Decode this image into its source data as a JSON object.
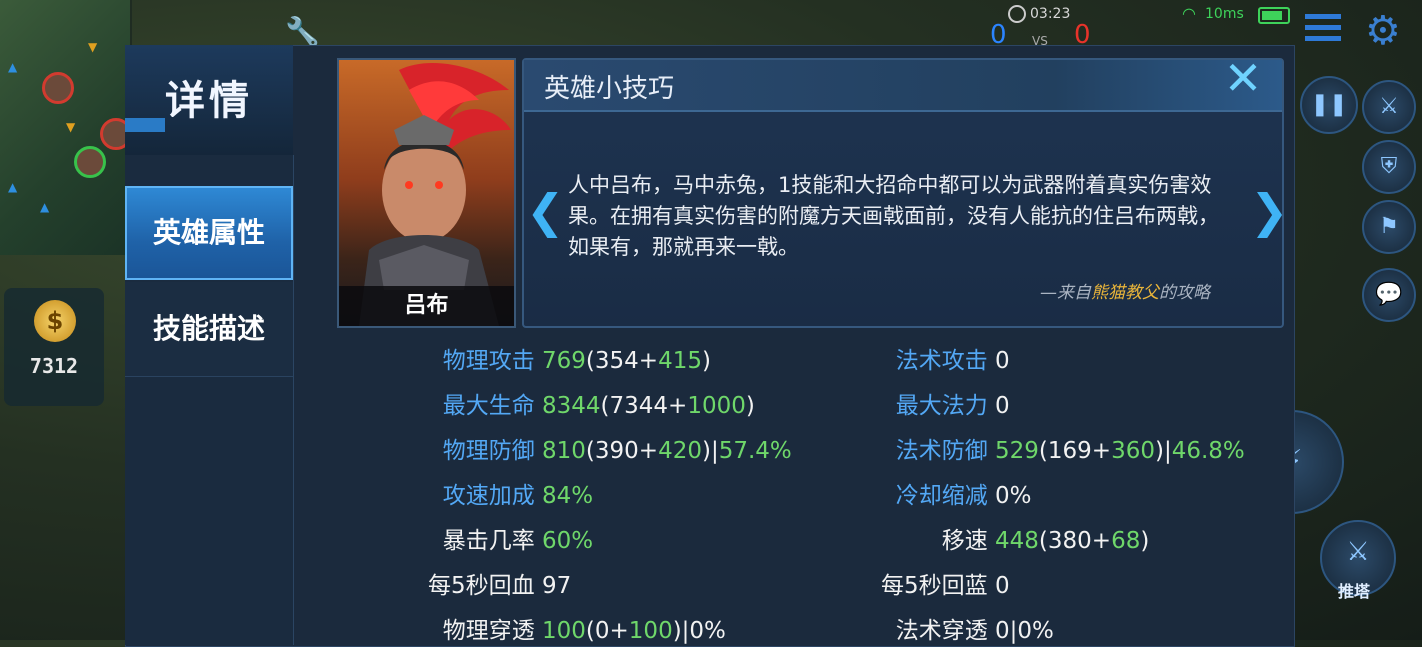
{
  "hud": {
    "time": "03:23",
    "ping": "10ms",
    "score_left": "0",
    "vs": "VS",
    "score_right": "0",
    "gold": "7312",
    "push_label": "推塔",
    "gold_icon_label": "$"
  },
  "panel": {
    "title": "详情",
    "tabs": [
      "英雄属性",
      "技能描述"
    ],
    "hero_name": "吕布",
    "tip": {
      "title": "英雄小技巧",
      "body": "人中吕布，马中赤兔，1技能和大招命中都可以为武器附着真实伤害效果。在拥有真实伤害的附魔方天画戟面前，没有人能抗的住吕布两戟，如果有，那就再来一戟。",
      "source_prefix": "—来自",
      "source_author": "熊猫教父",
      "source_suffix": "的攻略"
    }
  },
  "stats_left": [
    {
      "label": "物理攻击",
      "style": "blue",
      "parts": [
        [
          "769",
          "g"
        ],
        [
          "(354+",
          "w"
        ],
        [
          "415",
          "g"
        ],
        [
          ")",
          "w"
        ]
      ]
    },
    {
      "label": "最大生命",
      "style": "blue",
      "parts": [
        [
          "8344",
          "g"
        ],
        [
          "(7344+",
          "w"
        ],
        [
          "1000",
          "g"
        ],
        [
          ")",
          "w"
        ]
      ]
    },
    {
      "label": "物理防御",
      "style": "blue",
      "parts": [
        [
          "810",
          "g"
        ],
        [
          "(390+",
          "w"
        ],
        [
          "420",
          "g"
        ],
        [
          ")|",
          "w"
        ],
        [
          "57.4%",
          "g"
        ]
      ]
    },
    {
      "label": "攻速加成",
      "style": "blue",
      "parts": [
        [
          "84%",
          "g"
        ]
      ]
    },
    {
      "label": "暴击几率",
      "style": "white",
      "parts": [
        [
          "60%",
          "g"
        ]
      ]
    },
    {
      "label": "每5秒回血",
      "style": "white",
      "parts": [
        [
          "97",
          "w"
        ]
      ]
    },
    {
      "label": "物理穿透",
      "style": "white",
      "parts": [
        [
          "100",
          "g"
        ],
        [
          "(0+",
          "w"
        ],
        [
          "100",
          "g"
        ],
        [
          ")|0%",
          "w"
        ]
      ]
    }
  ],
  "stats_right": [
    {
      "label": "法术攻击",
      "style": "blue",
      "parts": [
        [
          "0",
          "w"
        ]
      ]
    },
    {
      "label": "最大法力",
      "style": "blue",
      "parts": [
        [
          "0",
          "w"
        ]
      ]
    },
    {
      "label": "法术防御",
      "style": "blue",
      "parts": [
        [
          "529",
          "g"
        ],
        [
          "(169+",
          "w"
        ],
        [
          "360",
          "g"
        ],
        [
          ")|",
          "w"
        ],
        [
          "46.8%",
          "g"
        ]
      ]
    },
    {
      "label": "冷却缩减",
      "style": "blue",
      "parts": [
        [
          "0%",
          "w"
        ]
      ]
    },
    {
      "label": "移速",
      "style": "white",
      "parts": [
        [
          "448",
          "g"
        ],
        [
          "(380+",
          "w"
        ],
        [
          "68",
          "g"
        ],
        [
          ")",
          "w"
        ]
      ]
    },
    {
      "label": "每5秒回蓝",
      "style": "white",
      "parts": [
        [
          "0",
          "w"
        ]
      ]
    },
    {
      "label": "法术穿透",
      "style": "white",
      "parts": [
        [
          "0|0%",
          "w"
        ]
      ]
    }
  ],
  "colors": {
    "label_blue": "#53a8f5",
    "value_green": "#6fd76a",
    "tab_active": "#2f8ad6",
    "close_cyan": "#6fd3ff",
    "author_gold": "#e8b43a"
  }
}
